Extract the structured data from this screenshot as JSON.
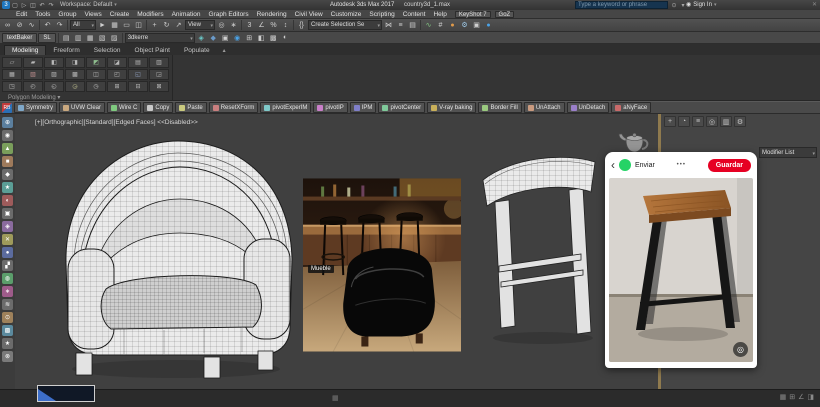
{
  "titlebar": {
    "quick_access": [
      {
        "name": "app-logo",
        "label": "3",
        "style": "background:#1f77c0;color:#fff;border-radius:2px"
      },
      {
        "name": "new-scene-icon",
        "label": "▢"
      },
      {
        "name": "open-file-icon",
        "label": "▷"
      },
      {
        "name": "save-file-icon",
        "label": "◫"
      },
      {
        "name": "undo-icon",
        "label": "↶"
      },
      {
        "name": "redo-icon",
        "label": "↷"
      }
    ],
    "workspace_label": "Workspace: Default",
    "app_title": "Autodesk 3ds Max 2017",
    "file_name": "country3d_1.max",
    "search_placeholder": "Type a keyword or phrase",
    "search_icon": "⊙",
    "search_dropdown_icon": "▾",
    "sign_in_icon": "◉",
    "sign_in_label": "Sign In",
    "close_icon": "✕"
  },
  "menubar": {
    "items": [
      "Edit",
      "Tools",
      "Group",
      "Views",
      "Create",
      "Modifiers",
      "Animation",
      "Graph Editors",
      "Rendering",
      "Civil View",
      "Customize",
      "Scripting",
      "Content",
      "Help"
    ],
    "plugin_buttons": [
      "KeyShot 7",
      "GoZ"
    ]
  },
  "toolbar_main": {
    "items": [
      {
        "name": "select-and-link-icon",
        "label": "∞"
      },
      {
        "name": "unlink-selection-icon",
        "label": "⊘"
      },
      {
        "name": "bind-to-space-warp-icon",
        "label": "∿"
      },
      {
        "name": "separator",
        "cls": "tb-sep",
        "label": "",
        "inter": "false"
      },
      {
        "name": "undo-icon",
        "label": "↶"
      },
      {
        "name": "redo-icon",
        "label": "↷"
      },
      {
        "name": "separator",
        "cls": "tb-sep",
        "label": "",
        "inter": "false"
      },
      {
        "name": "selection-filter-dropdown",
        "cls": "tb-combo",
        "label": "All",
        "style": "width:26px"
      },
      {
        "name": "select-object-icon",
        "label": "►"
      },
      {
        "name": "select-by-name-icon",
        "label": "▦"
      },
      {
        "name": "rectangular-selection-icon",
        "label": "▭"
      },
      {
        "name": "window-crossing-icon",
        "label": "◫"
      },
      {
        "name": "separator",
        "cls": "tb-sep",
        "label": "",
        "inter": "false"
      },
      {
        "name": "select-and-move-icon",
        "label": "+"
      },
      {
        "name": "select-and-rotate-icon",
        "label": "↻"
      },
      {
        "name": "select-and-scale-icon",
        "label": "↗"
      },
      {
        "name": "reference-coordinate-dropdown",
        "cls": "tb-combo",
        "label": "View",
        "style": "width:30px"
      },
      {
        "name": "use-pivot-center-icon",
        "label": "◎"
      },
      {
        "name": "select-and-manipulate-icon",
        "label": "∗"
      },
      {
        "name": "separator",
        "cls": "tb-sep",
        "label": "",
        "inter": "false"
      },
      {
        "name": "snaps-toggle-icon",
        "label": "3"
      },
      {
        "name": "angle-snap-icon",
        "label": "∠"
      },
      {
        "name": "percent-snap-icon",
        "label": "%"
      },
      {
        "name": "spinner-snap-icon",
        "label": "↕"
      },
      {
        "name": "separator",
        "cls": "tb-sep",
        "label": "",
        "inter": "false"
      },
      {
        "name": "named-selection-sets-icon",
        "label": "{}"
      },
      {
        "name": "create-selection-set-dropdown",
        "cls": "tb-combo",
        "label": "Create Selection Se",
        "style": "width:74px"
      },
      {
        "name": "mirror-icon",
        "label": "⋈"
      },
      {
        "name": "align-icon",
        "label": "≡"
      },
      {
        "name": "layer-manager-icon",
        "label": "▤"
      },
      {
        "name": "separator",
        "cls": "tb-sep",
        "label": "",
        "inter": "false"
      },
      {
        "name": "curve-editor-icon",
        "label": "∿",
        "style": "color:#7fbf7f"
      },
      {
        "name": "schematic-view-icon",
        "label": "#"
      },
      {
        "name": "material-editor-icon",
        "label": "●",
        "style": "color:#e09a4a"
      },
      {
        "name": "render-setup-icon",
        "label": "⚙",
        "style": "color:#9ec9e8"
      },
      {
        "name": "rendered-frame-icon",
        "label": "▣"
      },
      {
        "name": "render-production-icon",
        "label": "●",
        "style": "color:#4aa3e8"
      }
    ]
  },
  "toolbar_2": {
    "items": [
      {
        "name": "textbaker-button",
        "cls": "tb-btn",
        "label": "textBaker"
      },
      {
        "name": "sl-button",
        "cls": "tb-btn",
        "label": "SL"
      },
      {
        "name": "separator",
        "cls": "tb-sep",
        "label": "",
        "inter": "false"
      },
      {
        "name": "container-icon",
        "label": "▤"
      },
      {
        "name": "container-icon",
        "label": "▥"
      },
      {
        "name": "container-icon",
        "label": "▦"
      },
      {
        "name": "container-icon",
        "label": "▧"
      },
      {
        "name": "container-icon",
        "label": "▨"
      },
      {
        "name": "separator",
        "cls": "tb-sep",
        "label": "",
        "inter": "false"
      },
      {
        "name": "asset-dropdown",
        "cls": "tb-combo",
        "label": "3dkerre",
        "style": "width:70px"
      },
      {
        "name": "toolbar2-icon",
        "label": "◈",
        "style": "color:#6ac9c9"
      },
      {
        "name": "toolbar2-icon",
        "label": "◆",
        "style": "color:#6a9ac9"
      },
      {
        "name": "toolbar2-icon",
        "label": "▣"
      },
      {
        "name": "toolbar2-icon",
        "label": "◉",
        "style": "color:#4aa3e8"
      },
      {
        "name": "toolbar2-icon",
        "label": "⊞"
      },
      {
        "name": "toolbar2-icon",
        "label": "◧"
      },
      {
        "name": "toolbar2-icon",
        "label": "▩"
      },
      {
        "name": "toolbar2-icon",
        "label": "◐"
      }
    ]
  },
  "ribbon": {
    "tabs": [
      {
        "name": "tab-modeling",
        "cls": "rtab active",
        "label": "Modeling"
      },
      {
        "name": "tab-freeform",
        "cls": "rtab",
        "label": "Freeform"
      },
      {
        "name": "tab-selection",
        "cls": "rtab",
        "label": "Selection"
      },
      {
        "name": "tab-object-paint",
        "cls": "rtab",
        "label": "Object Paint"
      },
      {
        "name": "tab-populate",
        "cls": "rtab",
        "label": "Populate"
      }
    ],
    "minimize_icon": "▴",
    "buttons": [
      {
        "label": "▱"
      },
      {
        "label": "▰"
      },
      {
        "label": "◧"
      },
      {
        "label": "◨"
      },
      {
        "label": "◩",
        "style": "color:#8fbf8f"
      },
      {
        "label": "◪"
      },
      {
        "label": "▤"
      },
      {
        "label": "▥"
      },
      {
        "label": "▦"
      },
      {
        "label": "▧",
        "style": "color:#bf8f8f"
      },
      {
        "label": "▨"
      },
      {
        "label": "▩"
      },
      {
        "label": "◫"
      },
      {
        "label": "◰"
      },
      {
        "label": "◱",
        "style": "color:#8f9fbf"
      },
      {
        "label": "◲"
      },
      {
        "label": "◳"
      },
      {
        "label": "◴"
      },
      {
        "label": "◵"
      },
      {
        "label": "◶",
        "style": "color:#bfbf8f"
      },
      {
        "label": "◷"
      },
      {
        "label": "⊞"
      },
      {
        "label": "⊟"
      },
      {
        "label": "⊠"
      }
    ],
    "section_label": "Polygon Modeling ▾"
  },
  "scripts_toolbar": {
    "logo": "RB",
    "buttons": [
      {
        "label": "Symmetry",
        "dot": "background:#7fa8c9"
      },
      {
        "label": "UVW Clear",
        "dot": "background:#c9a87f"
      },
      {
        "label": "Wire C",
        "dot": "background:#7fc97f"
      },
      {
        "label": "Copy",
        "dot": "background:#c9c9c9"
      },
      {
        "label": "Paste",
        "dot": "background:#c9c97f"
      },
      {
        "label": "ResetXForm",
        "dot": "background:#c97f7f"
      },
      {
        "label": "pivotExperIM",
        "dot": "background:#7fc9c9"
      },
      {
        "label": "pivotIP",
        "dot": "background:#c97fc9"
      },
      {
        "label": "IPM",
        "dot": "background:#7f7fc9"
      },
      {
        "label": "pivotCenter",
        "dot": "background:#7fc99a"
      },
      {
        "label": "V-ray baking",
        "dot": "background:#c9b05a"
      },
      {
        "label": "Border Fill",
        "dot": "background:#9ac97f"
      },
      {
        "label": "UnAttach",
        "dot": "background:#c99a7f"
      },
      {
        "label": "UnDetach",
        "dot": "background:#9a7fc9"
      },
      {
        "label": "aNyFace",
        "dot": "background:#c96a6a"
      }
    ]
  },
  "left_strip": {
    "items": [
      {
        "label": "⊕",
        "style": "background:#5b7f9e"
      },
      {
        "label": "◉",
        "style": "background:#6b6b6b"
      },
      {
        "label": "▲",
        "style": "background:#7a9e5b"
      },
      {
        "label": "■",
        "style": "background:#9e7a5b"
      },
      {
        "label": "◆",
        "style": "background:#6b6b6b"
      },
      {
        "label": "★",
        "style": "background:#5b9e96"
      },
      {
        "label": "◐",
        "style": "background:#9e5b5b"
      },
      {
        "label": "▣",
        "style": "background:#6b6b6b"
      },
      {
        "label": "◈",
        "style": "background:#8a6b9e"
      },
      {
        "label": "✕",
        "style": "background:#9e9a5b"
      },
      {
        "label": "●",
        "style": "background:#5b6b9e"
      },
      {
        "label": "▞",
        "style": "background:#6b6b6b"
      },
      {
        "label": "◍",
        "style": "background:#5b9e6b"
      },
      {
        "label": "∗",
        "style": "background:#9e5b8a"
      },
      {
        "label": "≋",
        "style": "background:#6b6b6b"
      },
      {
        "label": "⊙",
        "style": "background:#9e815b"
      },
      {
        "label": "▩",
        "style": "background:#5b8a9e"
      },
      {
        "label": "★",
        "style": "background:#6b6b6b"
      },
      {
        "label": "⊗",
        "style": "background:#7a7a7a"
      }
    ]
  },
  "viewport": {
    "label": "[+][Orthographic][Standard][Edged Faces]  <<Disabled>>",
    "photo_tag": "Mueble"
  },
  "pinterest": {
    "back_icon": "‹",
    "share_style": "background:#25d366",
    "send_label": "Enviar",
    "more_icon": "•••",
    "save_label": "Guardar",
    "save_style": "background:#e60023;color:#fff",
    "lens_icon": "◎"
  },
  "command_panel": {
    "tabs": [
      {
        "name": "tab-create",
        "label": "+"
      },
      {
        "name": "tab-modify",
        "label": "◔"
      },
      {
        "name": "tab-hierarchy",
        "label": "≡"
      },
      {
        "name": "tab-motion",
        "label": "◎"
      },
      {
        "name": "tab-display",
        "label": "▥"
      },
      {
        "name": "tab-utilities",
        "label": "⚙"
      }
    ],
    "modifier_list_label": "Modifier List"
  },
  "statusbar": {
    "center_icon": "▦",
    "right_icons": [
      {
        "name": "grid-toggle-icon",
        "label": "▦"
      },
      {
        "name": "window-toggle-icon",
        "label": "⊞"
      },
      {
        "name": "angle-icon",
        "label": "∠"
      },
      {
        "name": "lock-toggle-icon",
        "label": "◨"
      }
    ]
  },
  "colors": {
    "pinterest_red": "#e60023",
    "share_green": "#25d366",
    "splitter_tan": "#8f7a4e",
    "viewport_bg": "#404040"
  }
}
